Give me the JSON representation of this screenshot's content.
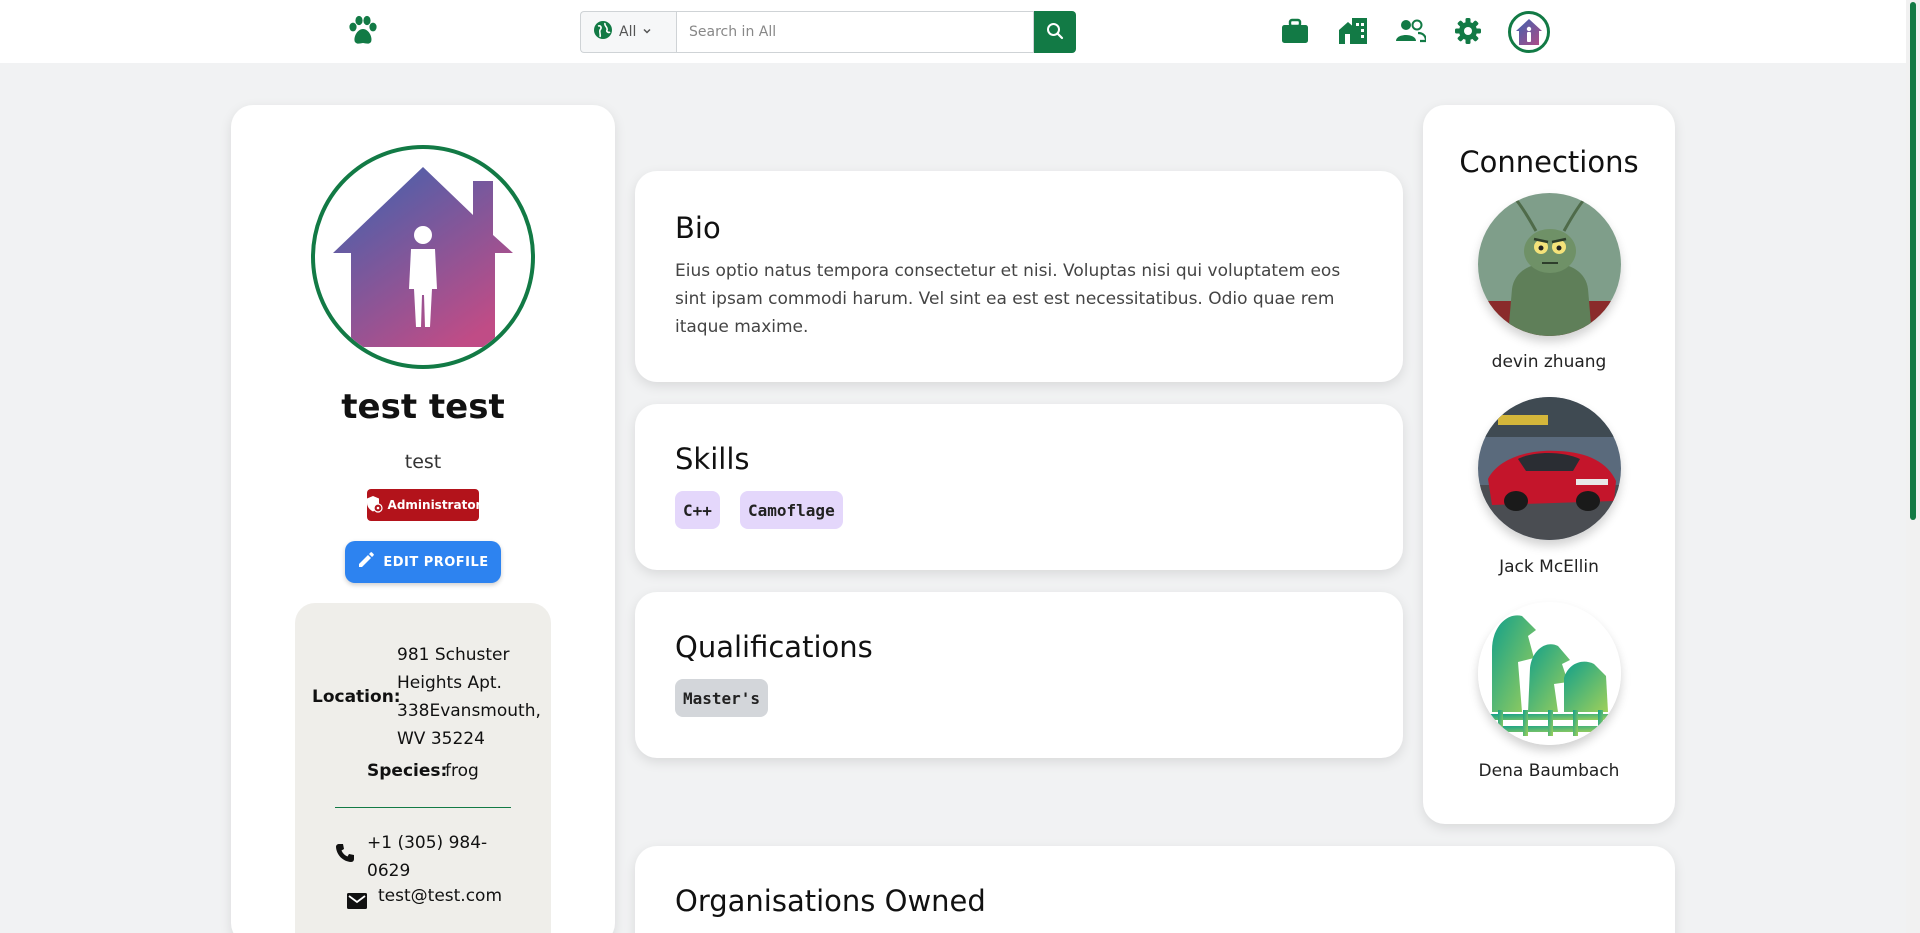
{
  "nav": {
    "search_scope": "All",
    "search_placeholder": "Search in All"
  },
  "profile": {
    "name": "test test",
    "username": "test",
    "role_badge": "Administrator",
    "edit_button": "EDIT PROFILE",
    "location_label": "Location:",
    "location_value": "981 Schuster Heights Apt. 338Evansmouth, WV 35224",
    "species_label": "Species:",
    "species_value": "frog",
    "phone": "+1 (305) 984-0629",
    "email": "test@test.com"
  },
  "bio": {
    "title": "Bio",
    "text": "Eius optio natus tempora consectetur et nisi. Voluptas nisi qui voluptatem eos sint ipsam commodi harum. Vel sint ea est est necessitatibus. Odio quae rem itaque maxime."
  },
  "skills": {
    "title": "Skills",
    "items": [
      "C++",
      "Camoflage"
    ]
  },
  "qualifications": {
    "title": "Qualifications",
    "items": [
      "Master's"
    ]
  },
  "organisations": {
    "title": "Organisations Owned"
  },
  "connections": {
    "title": "Connections",
    "people": [
      {
        "name": "devin zhuang"
      },
      {
        "name": "Jack McEllin"
      },
      {
        "name": "Dena Baumbach"
      }
    ]
  },
  "colors": {
    "brand_green": "#127a45",
    "admin_red": "#b3131b",
    "edit_blue": "#2d83f0",
    "skill_chip": "#e4d7fb",
    "qual_chip": "#d3d6da"
  }
}
